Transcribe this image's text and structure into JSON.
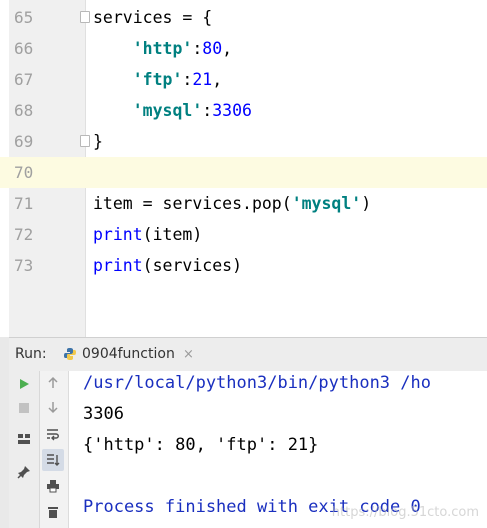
{
  "editor": {
    "current_line": "70",
    "lines": [
      {
        "num": "65",
        "tokens": [
          {
            "t": "services = {",
            "c": "plain"
          }
        ]
      },
      {
        "num": "66",
        "tokens": [
          {
            "t": "    ",
            "c": "plain"
          },
          {
            "t": "'http'",
            "c": "str"
          },
          {
            "t": ":",
            "c": "plain"
          },
          {
            "t": "80",
            "c": "num"
          },
          {
            "t": ",",
            "c": "plain"
          }
        ]
      },
      {
        "num": "67",
        "tokens": [
          {
            "t": "    ",
            "c": "plain"
          },
          {
            "t": "'ftp'",
            "c": "str"
          },
          {
            "t": ":",
            "c": "plain"
          },
          {
            "t": "21",
            "c": "num"
          },
          {
            "t": ",",
            "c": "plain"
          }
        ]
      },
      {
        "num": "68",
        "tokens": [
          {
            "t": "    ",
            "c": "plain"
          },
          {
            "t": "'mysql'",
            "c": "str"
          },
          {
            "t": ":",
            "c": "plain"
          },
          {
            "t": "3306",
            "c": "num"
          }
        ]
      },
      {
        "num": "69",
        "tokens": [
          {
            "t": "}",
            "c": "plain"
          }
        ]
      },
      {
        "num": "70",
        "tokens": []
      },
      {
        "num": "71",
        "tokens": [
          {
            "t": "item = services.pop(",
            "c": "plain"
          },
          {
            "t": "'mysql'",
            "c": "str"
          },
          {
            "t": ")",
            "c": "plain"
          }
        ]
      },
      {
        "num": "72",
        "tokens": [
          {
            "t": "print",
            "c": "num"
          },
          {
            "t": "(item)",
            "c": "plain"
          }
        ]
      },
      {
        "num": "73",
        "tokens": [
          {
            "t": "print",
            "c": "num"
          },
          {
            "t": "(services)",
            "c": "plain"
          }
        ]
      }
    ]
  },
  "run_panel": {
    "label": "Run:",
    "tab_name": "0904function",
    "tab_close": "×",
    "toolbar_left": [
      "run-icon",
      "stop-icon",
      "layout-icon",
      "pin-icon"
    ],
    "toolbar_right": [
      "up-arrow-icon",
      "down-arrow-icon",
      "soft-wrap-icon",
      "scroll-to-end-icon",
      "print-icon",
      "trash-icon"
    ]
  },
  "console": {
    "lines": [
      {
        "text": "/usr/local/python3/bin/python3 /ho",
        "color": "blue"
      },
      {
        "text": "3306",
        "color": "black"
      },
      {
        "text": "{'http': 80, 'ftp': 21}",
        "color": "black"
      },
      {
        "text": "",
        "color": "black"
      },
      {
        "text": "Process finished with exit code 0",
        "color": "blue"
      }
    ]
  },
  "watermark": "https://blog.51cto.com"
}
